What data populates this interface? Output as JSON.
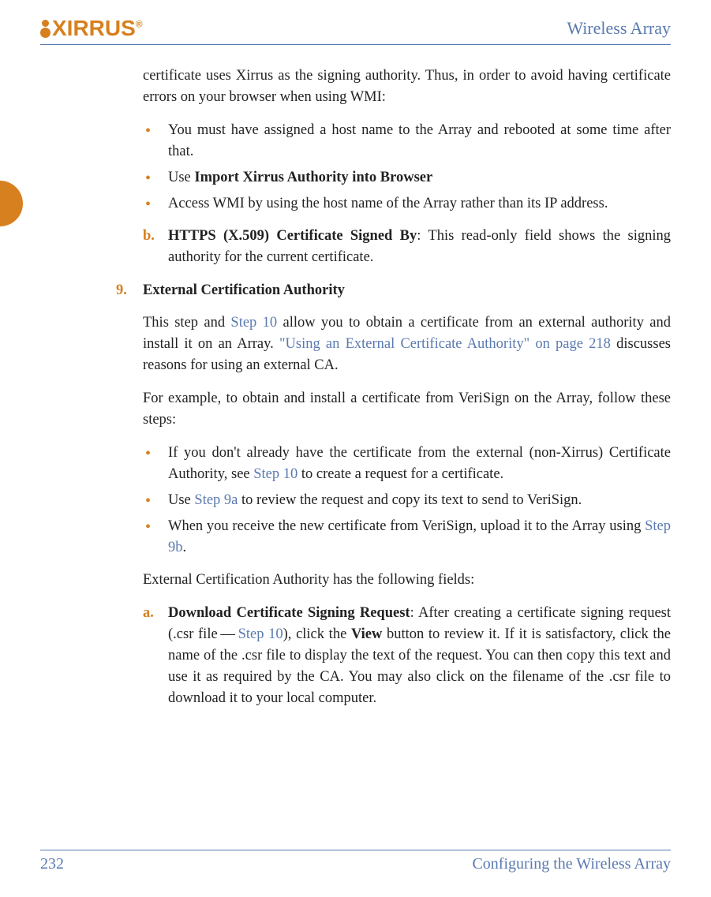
{
  "header": {
    "logo_text": "XIRRUS",
    "title": "Wireless Array"
  },
  "intro_para": "certificate uses Xirrus as the signing authority. Thus, in order to avoid having certificate errors on your browser when using WMI:",
  "bullets1": {
    "b1": "You must have assigned a host name to the Array and rebooted at some time after that.",
    "b2_pre": "Use ",
    "b2_bold": "Import Xirrus Authority into Browser",
    "b3": "Access WMI by using the host name of the Array rather than its IP address."
  },
  "item_b": {
    "label": "b.",
    "bold": "HTTPS (X.509) Certificate Signed By",
    "rest": ": This read-only field shows the signing authority for the current certificate."
  },
  "item9": {
    "label": "9.",
    "title": "External Certification Authority",
    "p1_pre": "This step and ",
    "p1_link1": "Step 10",
    "p1_mid": " allow you to obtain a certificate from an external authority and install it on an Array. ",
    "p1_link2": "\"Using an External Certificate Authority\" on page 218",
    "p1_post": " discusses reasons for using an external CA.",
    "p2": "For example, to obtain and install a certificate from VeriSign on the Array, follow these steps:",
    "bl1_pre": "If you don't already have the certificate from the external (non-Xirrus) Certificate Authority, see ",
    "bl1_link": "Step 10",
    "bl1_post": " to create a request for a certificate.",
    "bl2_pre": "Use ",
    "bl2_link": "Step 9a",
    "bl2_post": " to review the request and copy its text to send to VeriSign.",
    "bl3_pre": "When you receive the new certificate from VeriSign, upload it to the Array using ",
    "bl3_link": "Step 9b",
    "bl3_post": ".",
    "p3": "External Certification Authority has the following fields:",
    "a_label": "a.",
    "a_bold": "Download Certificate Signing Request",
    "a_pre": ": After creating a certificate signing request (.csr file — ",
    "a_link": "Step 10",
    "a_mid": "), click the ",
    "a_view": "View",
    "a_post": " button to review it. If it is satisfactory, click the name of the .csr file to display the text of the request. You can then copy this text and use it as required by the CA. You may also click on the filename of the .csr file to download it to your local computer."
  },
  "footer": {
    "page": "232",
    "section": "Configuring the Wireless Array"
  }
}
